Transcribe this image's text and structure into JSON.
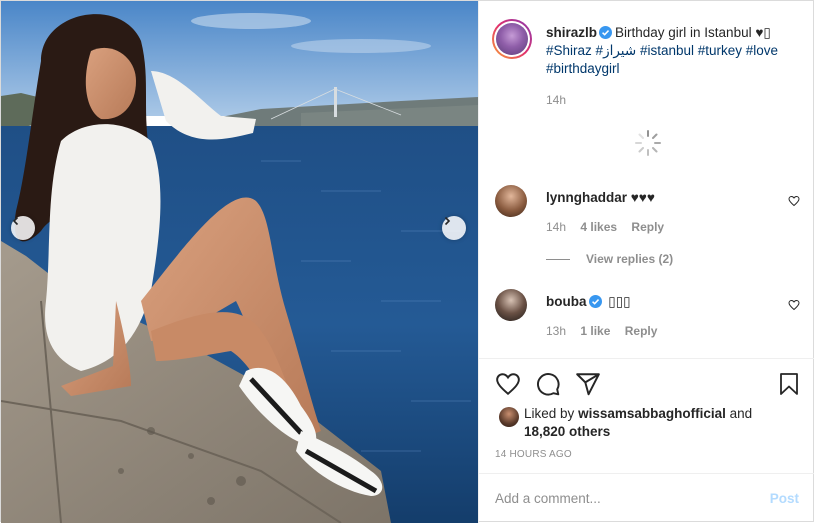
{
  "post": {
    "author": "shirazlb",
    "caption_text": "Birthday girl in Istanbul ♥▯",
    "hashtags": [
      "#Shiraz",
      "#شيراز",
      "#istanbul",
      "#turkey",
      "#love",
      "#birthdaygirl"
    ],
    "caption_time": "14h",
    "verified": true
  },
  "comments": [
    {
      "user": "lynnghaddar",
      "text": "♥♥♥",
      "time": "14h",
      "likes": "4 likes",
      "reply": "Reply",
      "verified": false
    },
    {
      "user": "bouba",
      "text": "▯▯▯",
      "time": "13h",
      "likes": "1 like",
      "reply": "Reply",
      "verified": true
    }
  ],
  "view_replies": "View replies (2)",
  "likes": {
    "prefix": "Liked by",
    "user": "wissamsabbaghofficial",
    "and": "and",
    "count": "18,820 others"
  },
  "timestamp": "14 HOURS AGO",
  "add_comment": {
    "placeholder": "Add a comment...",
    "post_label": "Post"
  },
  "icons": {
    "like": "heart-icon",
    "comment": "comment-icon",
    "share": "share-icon",
    "save": "bookmark-icon",
    "prev": "chevron-left-icon",
    "next": "chevron-right-icon",
    "verified": "verified-badge-icon",
    "loading": "spinner-icon"
  },
  "colors": {
    "link": "#00376b",
    "muted": "#8e8e8e",
    "verified": "#3897f0",
    "post_disabled": "#b3dbff"
  }
}
